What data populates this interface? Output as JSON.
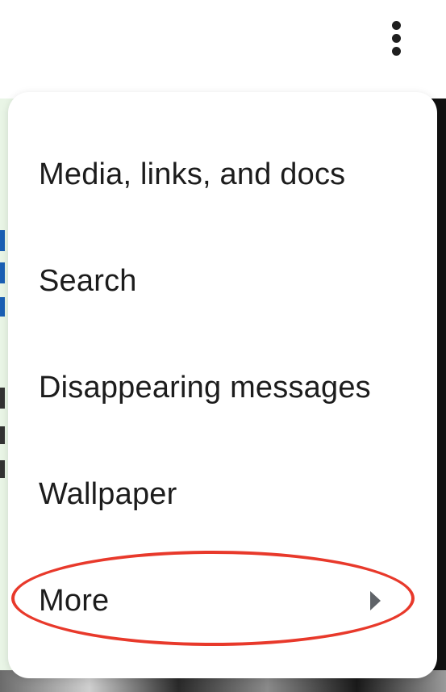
{
  "appbar": {
    "overflow_icon": "more-vert-icon"
  },
  "menu": {
    "items": [
      {
        "label": "Media, links, and docs"
      },
      {
        "label": "Search"
      },
      {
        "label": "Disappearing messages"
      },
      {
        "label": "Wallpaper"
      },
      {
        "label": "More",
        "has_submenu": true,
        "icon": "chevron-right-icon"
      }
    ]
  },
  "annotation": {
    "color": "#e8392b"
  }
}
